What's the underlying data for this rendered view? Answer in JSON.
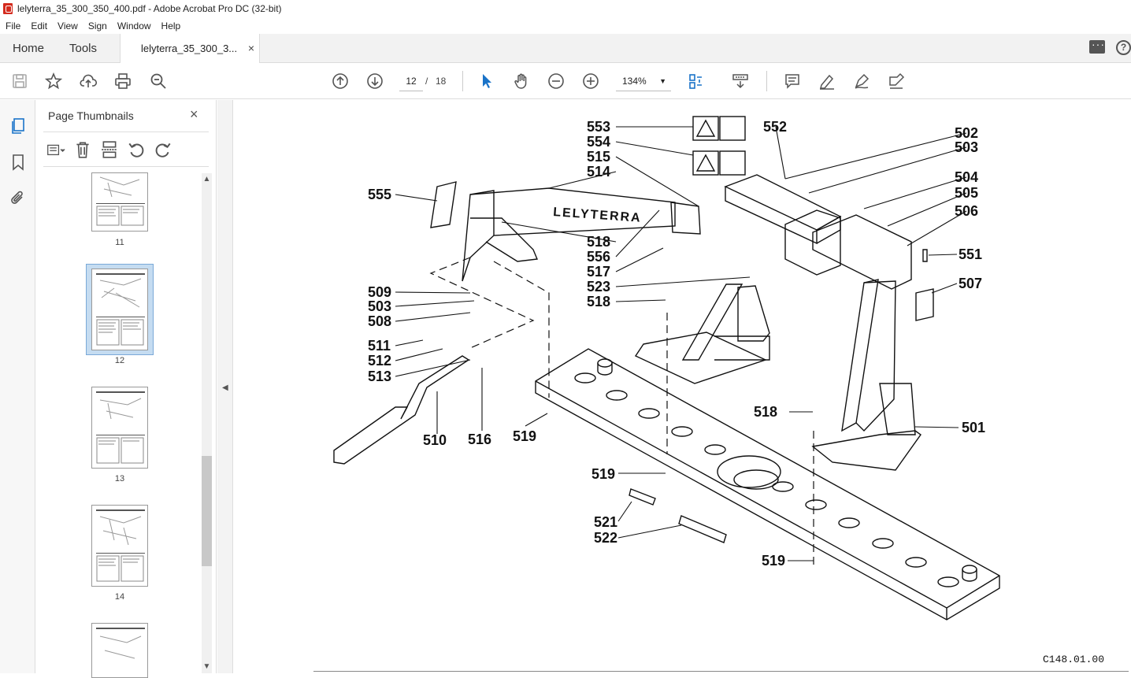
{
  "window": {
    "title": "lelyterra_35_300_350_400.pdf - Adobe Acrobat Pro DC (32-bit)"
  },
  "menu": [
    "File",
    "Edit",
    "View",
    "Sign",
    "Window",
    "Help"
  ],
  "tabs": {
    "home": "Home",
    "tools": "Tools",
    "document": "lelyterra_35_300_3...",
    "close": "×"
  },
  "toolbar": {
    "page_current": "12",
    "page_separator": "/",
    "page_total": "18",
    "zoom": "134%"
  },
  "thumbnails": {
    "title": "Page Thumbnails",
    "close": "×",
    "pages": [
      "11",
      "12",
      "13",
      "14"
    ],
    "selected": "12"
  },
  "drawing": {
    "brand_text": "LELYTERRA",
    "figure_code": "C148.01.00",
    "callouts": {
      "c553": "553",
      "c554": "554",
      "c515": "515",
      "c514": "514",
      "c555": "555",
      "c518a": "518",
      "c556": "556",
      "c517": "517",
      "c523": "523",
      "c518b": "518",
      "c509": "509",
      "c503a": "503",
      "c508": "508",
      "c511": "511",
      "c512": "512",
      "c513": "513",
      "c510": "510",
      "c516": "516",
      "c519a": "519",
      "c552": "552",
      "c502": "502",
      "c503b": "503",
      "c504": "504",
      "c505": "505",
      "c506": "506",
      "c551": "551",
      "c507": "507",
      "c518c": "518",
      "c501": "501",
      "c519b": "519",
      "c521": "521",
      "c522": "522",
      "c519c": "519"
    }
  },
  "colors": {
    "accent_blue": "#1a73c8",
    "selection": "#c5dcf1",
    "pdf_red": "#d42b1e"
  }
}
